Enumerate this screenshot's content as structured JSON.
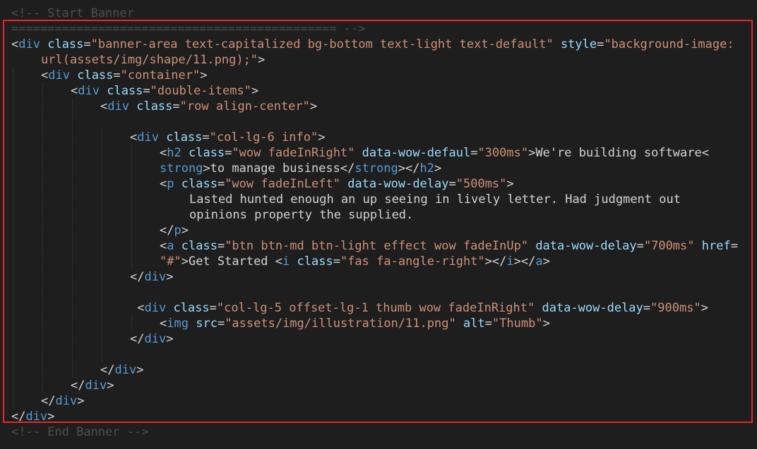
{
  "lines": [
    {
      "indent": 0,
      "tokens": [
        {
          "k": "c",
          "t": "<!-- Start Banner"
        }
      ]
    },
    {
      "indent": 0,
      "tokens": [
        {
          "k": "c",
          "t": "============================================= -->"
        }
      ]
    },
    {
      "indent": 0,
      "tokens": [
        {
          "k": "x",
          "t": "<"
        },
        {
          "k": "t",
          "t": "div"
        },
        {
          "k": "x",
          "t": " "
        },
        {
          "k": "a",
          "t": "class"
        },
        {
          "k": "x",
          "t": "="
        },
        {
          "k": "v",
          "t": "\"banner-area text-capitalized bg-bottom text-light text-default\""
        },
        {
          "k": "x",
          "t": " "
        },
        {
          "k": "a",
          "t": "style"
        },
        {
          "k": "x",
          "t": "="
        },
        {
          "k": "v",
          "t": "\"background-image:"
        }
      ]
    },
    {
      "indent": 1,
      "tokens": [
        {
          "k": "v",
          "t": "url(assets/img/shape/11.png);\""
        },
        {
          "k": "x",
          "t": ">"
        }
      ]
    },
    {
      "indent": 1,
      "tokens": [
        {
          "k": "x",
          "t": "<"
        },
        {
          "k": "t",
          "t": "div"
        },
        {
          "k": "x",
          "t": " "
        },
        {
          "k": "a",
          "t": "class"
        },
        {
          "k": "x",
          "t": "="
        },
        {
          "k": "v",
          "t": "\"container\""
        },
        {
          "k": "x",
          "t": ">"
        }
      ]
    },
    {
      "indent": 2,
      "tokens": [
        {
          "k": "x",
          "t": "<"
        },
        {
          "k": "t",
          "t": "div"
        },
        {
          "k": "x",
          "t": " "
        },
        {
          "k": "a",
          "t": "class"
        },
        {
          "k": "x",
          "t": "="
        },
        {
          "k": "v",
          "t": "\"double-items\""
        },
        {
          "k": "x",
          "t": ">"
        }
      ]
    },
    {
      "indent": 3,
      "tokens": [
        {
          "k": "x",
          "t": "<"
        },
        {
          "k": "t",
          "t": "div"
        },
        {
          "k": "x",
          "t": " "
        },
        {
          "k": "a",
          "t": "class"
        },
        {
          "k": "x",
          "t": "="
        },
        {
          "k": "v",
          "t": "\"row align-center\""
        },
        {
          "k": "x",
          "t": ">"
        }
      ]
    },
    {
      "indent": 0,
      "tokens": []
    },
    {
      "indent": 4,
      "tokens": [
        {
          "k": "x",
          "t": "<"
        },
        {
          "k": "t",
          "t": "div"
        },
        {
          "k": "x",
          "t": " "
        },
        {
          "k": "a",
          "t": "class"
        },
        {
          "k": "x",
          "t": "="
        },
        {
          "k": "v",
          "t": "\"col-lg-6 info\""
        },
        {
          "k": "x",
          "t": ">"
        }
      ]
    },
    {
      "indent": 5,
      "tokens": [
        {
          "k": "x",
          "t": "<"
        },
        {
          "k": "t",
          "t": "h2"
        },
        {
          "k": "x",
          "t": " "
        },
        {
          "k": "a",
          "t": "class"
        },
        {
          "k": "x",
          "t": "="
        },
        {
          "k": "v",
          "t": "\"wow fadeInRight\""
        },
        {
          "k": "x",
          "t": " "
        },
        {
          "k": "a",
          "t": "data-wow-defaul"
        },
        {
          "k": "x",
          "t": "="
        },
        {
          "k": "v",
          "t": "\"300ms\""
        },
        {
          "k": "x",
          "t": ">We're building software<"
        }
      ]
    },
    {
      "indent": 5,
      "tokens": [
        {
          "k": "t",
          "t": "strong"
        },
        {
          "k": "x",
          "t": ">to manage business</"
        },
        {
          "k": "t",
          "t": "strong"
        },
        {
          "k": "x",
          "t": "></"
        },
        {
          "k": "t",
          "t": "h2"
        },
        {
          "k": "x",
          "t": ">"
        }
      ]
    },
    {
      "indent": 5,
      "tokens": [
        {
          "k": "x",
          "t": "<"
        },
        {
          "k": "t",
          "t": "p"
        },
        {
          "k": "x",
          "t": " "
        },
        {
          "k": "a",
          "t": "class"
        },
        {
          "k": "x",
          "t": "="
        },
        {
          "k": "v",
          "t": "\"wow fadeInLeft\""
        },
        {
          "k": "x",
          "t": " "
        },
        {
          "k": "a",
          "t": "data-wow-delay"
        },
        {
          "k": "x",
          "t": "="
        },
        {
          "k": "v",
          "t": "\"500ms\""
        },
        {
          "k": "x",
          "t": ">"
        }
      ]
    },
    {
      "indent": 6,
      "tokens": [
        {
          "k": "x",
          "t": "Lasted hunted enough an up seeing in lively letter. Had judgment out"
        }
      ]
    },
    {
      "indent": 6,
      "tokens": [
        {
          "k": "x",
          "t": "opinions property the supplied."
        }
      ]
    },
    {
      "indent": 5,
      "tokens": [
        {
          "k": "x",
          "t": "</"
        },
        {
          "k": "t",
          "t": "p"
        },
        {
          "k": "x",
          "t": ">"
        }
      ]
    },
    {
      "indent": 5,
      "tokens": [
        {
          "k": "x",
          "t": "<"
        },
        {
          "k": "t",
          "t": "a"
        },
        {
          "k": "x",
          "t": " "
        },
        {
          "k": "a",
          "t": "class"
        },
        {
          "k": "x",
          "t": "="
        },
        {
          "k": "v",
          "t": "\"btn btn-md btn-light effect wow fadeInUp\""
        },
        {
          "k": "x",
          "t": " "
        },
        {
          "k": "a",
          "t": "data-wow-delay"
        },
        {
          "k": "x",
          "t": "="
        },
        {
          "k": "v",
          "t": "\"700ms\""
        },
        {
          "k": "x",
          "t": " "
        },
        {
          "k": "a",
          "t": "href"
        },
        {
          "k": "x",
          "t": "="
        }
      ]
    },
    {
      "indent": 5,
      "tokens": [
        {
          "k": "v",
          "t": "\"#\""
        },
        {
          "k": "x",
          "t": ">Get Started <"
        },
        {
          "k": "t",
          "t": "i"
        },
        {
          "k": "x",
          "t": " "
        },
        {
          "k": "a",
          "t": "class"
        },
        {
          "k": "x",
          "t": "="
        },
        {
          "k": "v",
          "t": "\"fas fa-angle-right\""
        },
        {
          "k": "x",
          "t": "></"
        },
        {
          "k": "t",
          "t": "i"
        },
        {
          "k": "x",
          "t": "></"
        },
        {
          "k": "t",
          "t": "a"
        },
        {
          "k": "x",
          "t": ">"
        }
      ]
    },
    {
      "indent": 4,
      "tokens": [
        {
          "k": "x",
          "t": "</"
        },
        {
          "k": "t",
          "t": "div"
        },
        {
          "k": "x",
          "t": ">"
        }
      ]
    },
    {
      "indent": 0,
      "tokens": []
    },
    {
      "indent": 4,
      "tokens": [
        {
          "k": "x",
          "t": " <"
        },
        {
          "k": "t",
          "t": "div"
        },
        {
          "k": "x",
          "t": " "
        },
        {
          "k": "a",
          "t": "class"
        },
        {
          "k": "x",
          "t": "="
        },
        {
          "k": "v",
          "t": "\"col-lg-5 offset-lg-1 thumb wow fadeInRight\""
        },
        {
          "k": "x",
          "t": " "
        },
        {
          "k": "a",
          "t": "data-wow-delay"
        },
        {
          "k": "x",
          "t": "="
        },
        {
          "k": "v",
          "t": "\"900ms\""
        },
        {
          "k": "x",
          "t": ">"
        }
      ]
    },
    {
      "indent": 5,
      "tokens": [
        {
          "k": "x",
          "t": "<"
        },
        {
          "k": "t",
          "t": "img"
        },
        {
          "k": "x",
          "t": " "
        },
        {
          "k": "a",
          "t": "src"
        },
        {
          "k": "x",
          "t": "="
        },
        {
          "k": "v",
          "t": "\"assets/img/illustration/11.png\""
        },
        {
          "k": "x",
          "t": " "
        },
        {
          "k": "a",
          "t": "alt"
        },
        {
          "k": "x",
          "t": "="
        },
        {
          "k": "v",
          "t": "\"Thumb\""
        },
        {
          "k": "x",
          "t": ">"
        }
      ]
    },
    {
      "indent": 4,
      "tokens": [
        {
          "k": "x",
          "t": "</"
        },
        {
          "k": "t",
          "t": "div"
        },
        {
          "k": "x",
          "t": ">"
        }
      ]
    },
    {
      "indent": 0,
      "tokens": []
    },
    {
      "indent": 3,
      "tokens": [
        {
          "k": "x",
          "t": "</"
        },
        {
          "k": "t",
          "t": "div"
        },
        {
          "k": "x",
          "t": ">"
        }
      ]
    },
    {
      "indent": 2,
      "tokens": [
        {
          "k": "x",
          "t": "</"
        },
        {
          "k": "t",
          "t": "div"
        },
        {
          "k": "x",
          "t": ">"
        }
      ]
    },
    {
      "indent": 1,
      "tokens": [
        {
          "k": "x",
          "t": "</"
        },
        {
          "k": "t",
          "t": "div"
        },
        {
          "k": "x",
          "t": ">"
        }
      ]
    },
    {
      "indent": 0,
      "tokens": [
        {
          "k": "x",
          "t": "</"
        },
        {
          "k": "t",
          "t": "div"
        },
        {
          "k": "x",
          "t": ">"
        }
      ]
    },
    {
      "indent": 0,
      "tokens": [
        {
          "k": "c",
          "t": "<!-- End Banner -->"
        }
      ]
    }
  ],
  "colors": {
    "background": "#1e1e1e",
    "tag": "#569cd6",
    "attribute": "#9cdcfe",
    "string": "#ce9178",
    "text": "#d4d4d4",
    "comment": "#4e4e4e",
    "selection_border": "#e3262b"
  }
}
